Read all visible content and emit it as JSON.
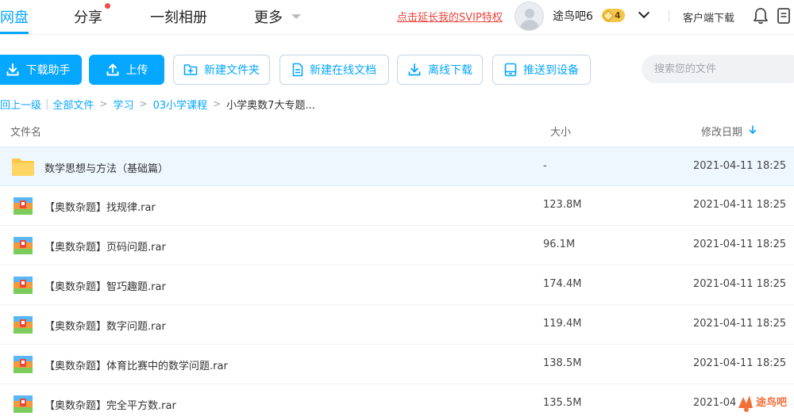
{
  "nav": {
    "tabs": [
      {
        "label": "网盘",
        "active": true
      },
      {
        "label": "分享",
        "badge_dot": true
      },
      {
        "label": "一刻相册"
      },
      {
        "label": "更多"
      }
    ],
    "svip_link": "点击延长我的SVIP特权",
    "username": "途鸟吧6",
    "vip_level": "4",
    "client_download": "客户端下载",
    "accent_color": "#06a7ff"
  },
  "toolbar": {
    "buttons": [
      {
        "label": "下载助手",
        "icon": "download-icon"
      },
      {
        "label": "上传",
        "icon": "upload-icon"
      },
      {
        "label": "新建文件夹",
        "icon": "new-folder-icon"
      },
      {
        "label": "新建在线文档",
        "icon": "new-doc-icon"
      },
      {
        "label": "离线下载",
        "icon": "offline-download-icon"
      },
      {
        "label": "推送到设备",
        "icon": "push-device-icon"
      }
    ],
    "search_placeholder": "搜索您的文件"
  },
  "breadcrumb": {
    "back": "回上一级",
    "items": [
      "全部文件",
      "学习",
      "03小学课程"
    ],
    "current": "小学奥数7大专题..."
  },
  "table": {
    "columns": {
      "name": "文件名",
      "size": "大小",
      "modified": "修改日期"
    },
    "rows": [
      {
        "name": "数学思想与方法（基础篇）",
        "size": "-",
        "date": "2021-04-11  18:25",
        "type": "folder",
        "selected": true
      },
      {
        "name": "【奥数杂题】找规律.rar",
        "size": "123.8M",
        "date": "2021-04-11  18:25",
        "type": "rar"
      },
      {
        "name": "【奥数杂题】页码问题.rar",
        "size": "96.1M",
        "date": "2021-04-11  18:25",
        "type": "rar"
      },
      {
        "name": "【奥数杂题】智巧趣题.rar",
        "size": "174.4M",
        "date": "2021-04-11  18:25",
        "type": "rar"
      },
      {
        "name": "【奥数杂题】数字问题.rar",
        "size": "119.4M",
        "date": "2021-04-11  18:25",
        "type": "rar"
      },
      {
        "name": "【奥数杂题】体育比赛中的数学问题.rar",
        "size": "138.5M",
        "date": "2021-04-11  18:25",
        "type": "rar"
      },
      {
        "name": "【奥数杂题】完全平方数.rar",
        "size": "135.5M",
        "date": "2021-04",
        "type": "rar"
      }
    ]
  },
  "watermark": "途鸟吧"
}
